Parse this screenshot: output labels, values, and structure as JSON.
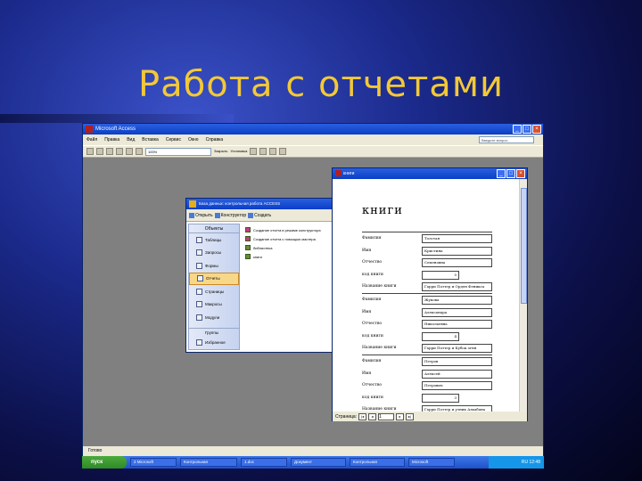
{
  "slide": {
    "title": "Работа с отчетами"
  },
  "access": {
    "title": "Microsoft Access",
    "controls": [
      "_",
      "□",
      "×"
    ],
    "menu": [
      "Файл",
      "Правка",
      "Вид",
      "Вставка",
      "Сервис",
      "Окно",
      "Справка"
    ],
    "help_placeholder": "Введите вопрос",
    "zoom": "100%",
    "toolbar_close": "Закрыть",
    "toolbar_setup": "Установка",
    "status": "Готово"
  },
  "db": {
    "title": "База данных: контрольная работа ACCESS",
    "toolbar": [
      "Открыть",
      "Конструктор",
      "Создать"
    ],
    "sidebar_header": "Объекты",
    "sidebar_items": [
      "Таблицы",
      "Запросы",
      "Формы",
      "Отчеты",
      "Страницы",
      "Макросы",
      "Модули"
    ],
    "group_header": "Группы",
    "group_items": [
      "Избранное"
    ],
    "list_items": [
      "Создание отчета в режиме конструктора",
      "Создание отчета с помощью мастера",
      "библиотека",
      "книги"
    ]
  },
  "report": {
    "title": "книги",
    "heading": "книги",
    "labels": {
      "surname": "Фамилия",
      "name": "Имя",
      "patronymic": "Отчество",
      "code": "код книги",
      "book_title": "Название книги"
    },
    "records": [
      {
        "surname": "Толстая",
        "name": "Кристина",
        "patronymic": "Семеновна",
        "code": "5",
        "book_title": "Гарри Поттер и Орден Феникса"
      },
      {
        "surname": "Жукова",
        "name": "Александра",
        "patronymic": "Николаевна",
        "code": "4",
        "book_title": "Гарри Поттер и Кубок огня"
      },
      {
        "surname": "Петров",
        "name": "Алексей",
        "patronymic": "Петрович",
        "code": "3",
        "book_title": "Гарри Поттер и узник Азкабана"
      }
    ],
    "page_label": "Страница:",
    "page_value": "1"
  },
  "taskbar": {
    "start": "пуск",
    "items": [
      "2 Microsoft",
      "Контрольная",
      "1.doc",
      "Документ",
      "Контрольная",
      "Microsoft"
    ],
    "tray": "RU  12:48"
  }
}
